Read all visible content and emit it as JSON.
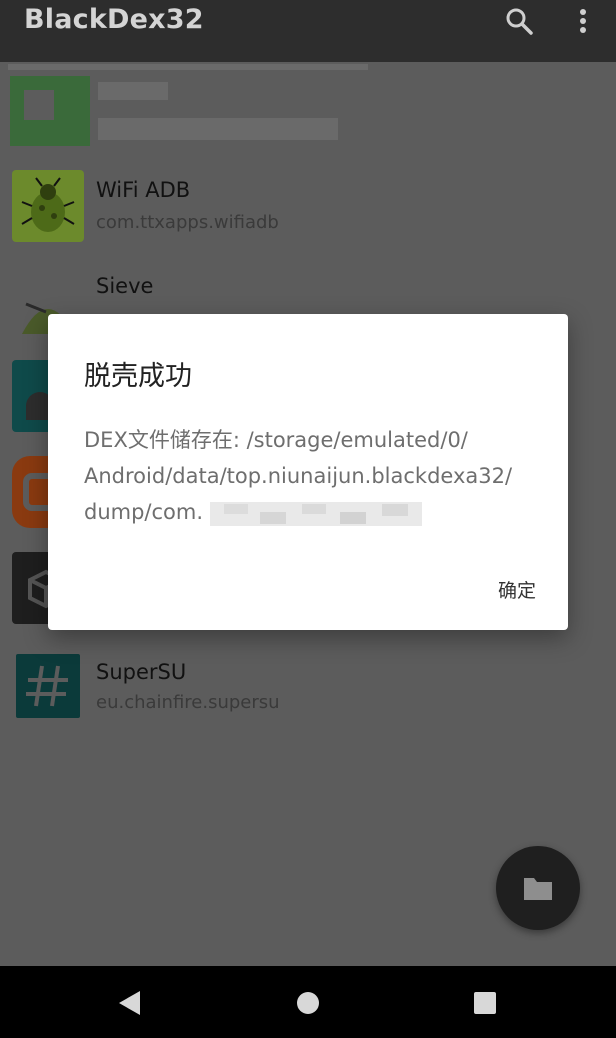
{
  "app_bar": {
    "title": "BlackDex32",
    "search_icon": "search-icon",
    "overflow_icon": "more-vert-icon"
  },
  "apps": [
    {
      "name": "",
      "package": "",
      "icon": "blurred-app-icon"
    },
    {
      "name": "WiFi ADB",
      "package": "com.ttxapps.wifiadb",
      "icon": "bug-icon"
    },
    {
      "name": "Sieve",
      "package": "",
      "icon": "sieve-app-icon"
    },
    {
      "name": "",
      "package": "",
      "icon": "android-app-icon"
    },
    {
      "name": "",
      "package": "",
      "icon": "orange-app-icon"
    },
    {
      "name": "",
      "package": "",
      "icon": "cube-app-icon"
    },
    {
      "name": "SuperSU",
      "package": "eu.chainfire.supersu",
      "icon": "hash-icon"
    }
  ],
  "dialog": {
    "title": "脱壳成功",
    "message_line1": "DEX文件储存在: /storage/emulated/0/",
    "message_line2": "Android/data/top.niunaijun.blackdexa32/",
    "message_line3": "dump/com.",
    "ok_label": "确定"
  },
  "fab": {
    "icon": "folder-icon"
  },
  "nav": {
    "back": "back-icon",
    "home": "home-icon",
    "recents": "recents-icon"
  },
  "colors": {
    "app_bar": "#2d2d2d",
    "scrim_list": "#5c5c5c",
    "dialog": "#ffffff",
    "fab": "#1f1f1f"
  }
}
